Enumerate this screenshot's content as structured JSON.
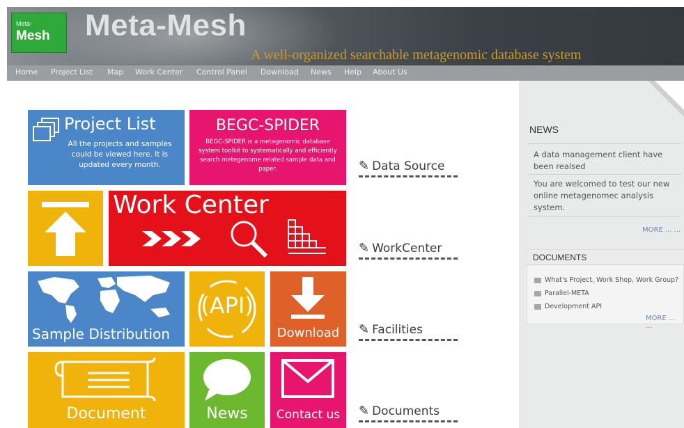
{
  "header": {
    "logo_small": "Meta-",
    "logo_big": "Mesh",
    "title": "Meta-Mesh",
    "tagline": "A well-organized searchable metagenomic database system"
  },
  "nav": [
    "Home",
    "Project List",
    "Map",
    "Work Center",
    "Control Panel",
    "Download",
    "News",
    "Help",
    "About Us"
  ],
  "tiles": {
    "project": {
      "title": "Project List",
      "desc": "All the projects and samples could be viewed here. It is updated every month."
    },
    "spider": {
      "title": "BEGC-SPIDER",
      "desc": "BEGC-SPIDER is a metagenomic database system toolkit to systematically and efficiently search metegenome related sample data and paper."
    },
    "work": {
      "title": "Work Center"
    },
    "sample": {
      "title": "Sample Distribution"
    },
    "api": {
      "title": "(API)"
    },
    "download": {
      "title": "Download"
    },
    "document": {
      "title": "Document"
    },
    "news": {
      "title": "News"
    },
    "contact": {
      "title": "Contact us"
    }
  },
  "sections": [
    "Data Source",
    "WorkCenter",
    "Facilities",
    "Documents"
  ],
  "side": {
    "news_title": "NEWS",
    "news_items": [
      "A data management client have been realsed",
      "You are welcomed to test our new online metagenomec analysis system."
    ],
    "news_more": "MORE ... ...",
    "docs_title": "DOCUMENTS",
    "doc_items": [
      "What's Project, Work Shop, Work Group?",
      "Parallel-META",
      "Development API"
    ],
    "docs_more": "MORE ... ..."
  },
  "colors": {
    "blue": "#4a86c8",
    "pink": "#e8156e",
    "yellow": "#f0b30b",
    "red": "#e4101a",
    "orange": "#e0602a",
    "green": "#6cb82e",
    "logo_green": "#2fa93a",
    "tagline_gold": "#c79a2c"
  },
  "icons": [
    "windows-stack-icon",
    "up-arrow-icon",
    "chevrons-icon",
    "magnifier-icon",
    "grid-chart-icon",
    "world-map-icon",
    "download-arrow-icon",
    "scroll-document-icon",
    "speech-bubble-icon",
    "envelope-icon",
    "pen-icon"
  ]
}
